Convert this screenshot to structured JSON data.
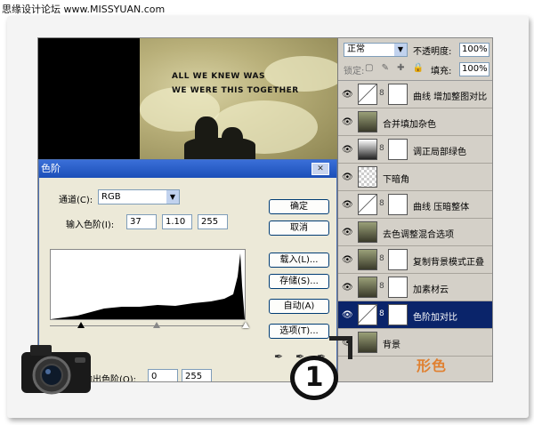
{
  "watermark": "思缘设计论坛  www.MISSYUAN.com",
  "photo_text": [
    "ALL WE KNEW WAS",
    "WE WERE THIS TOGETHER"
  ],
  "layers_panel": {
    "blend_mode": "正常",
    "opacity_label": "不透明度:",
    "opacity_value": "100%",
    "lock_label": "锁定:",
    "fill_label": "填充:",
    "fill_value": "100%",
    "layers": [
      {
        "name": "曲线 增加整图对比",
        "thumb": "curves-icon",
        "mask": true,
        "selected": false
      },
      {
        "name": "合并填加杂色",
        "thumb": "photo-thumb",
        "mask": false,
        "selected": false
      },
      {
        "name": "调正局部绿色",
        "thumb": "gradient-thumb",
        "mask": true,
        "selected": false
      },
      {
        "name": "下暗角",
        "thumb": "transparent-thumb",
        "mask": false,
        "selected": false
      },
      {
        "name": "曲线 压暗整体",
        "thumb": "curves-icon",
        "mask": true,
        "selected": false
      },
      {
        "name": "去色调整混合选项",
        "thumb": "photo-thumb",
        "mask": false,
        "selected": false
      },
      {
        "name": "复制背景模式正叠",
        "thumb": "photo-thumb",
        "mask": true,
        "selected": false
      },
      {
        "name": "加素材云",
        "thumb": "photo-thumb",
        "mask": true,
        "selected": false
      },
      {
        "name": "色阶加对比",
        "thumb": "levels-icon",
        "mask": true,
        "selected": true
      },
      {
        "name": "背景",
        "thumb": "photo-thumb",
        "mask": false,
        "selected": false
      }
    ]
  },
  "levels_dialog": {
    "title": "色阶",
    "channel_label": "通道(C):",
    "channel_value": "RGB",
    "input_label": "输入色阶(I):",
    "input_values": [
      "37",
      "1.10",
      "255"
    ],
    "output_label": "输出色阶(O):",
    "output_values": [
      "0",
      "255"
    ],
    "buttons": [
      "确定",
      "取消",
      "载入(L)...",
      "存储(S)...",
      "自动(A)",
      "选项(T)..."
    ]
  },
  "badge_number": "1",
  "logo_text": "形色"
}
